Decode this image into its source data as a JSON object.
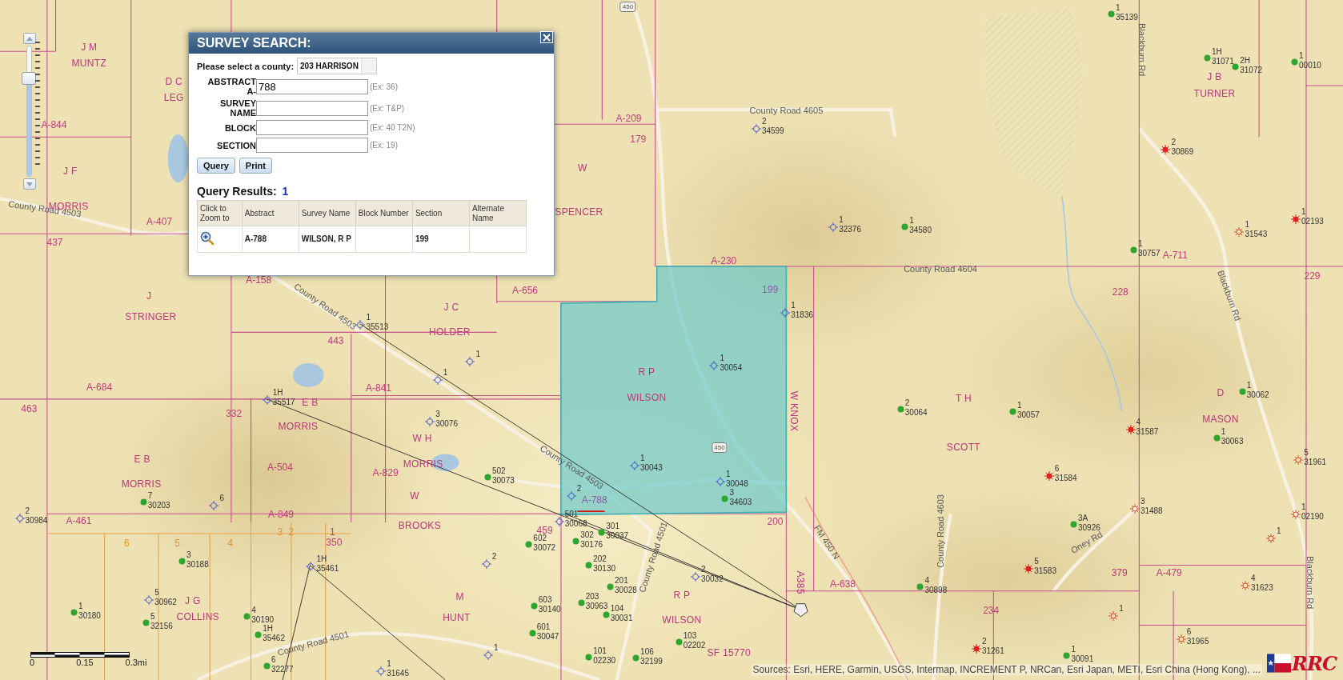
{
  "map": {
    "survey_labels": [
      {
        "text": "J M"
      },
      {
        "text": "MUNTZ"
      },
      {
        "text": "D C"
      },
      {
        "text": "J B"
      },
      {
        "text": "LEG"
      },
      {
        "text": "TURNER"
      },
      {
        "text": "J F"
      },
      {
        "text": "W"
      },
      {
        "text": "MORRIS"
      },
      {
        "text": "SPENCER"
      },
      {
        "text": "J"
      },
      {
        "text": "J C"
      },
      {
        "text": "STRINGER"
      },
      {
        "text": "HOLDER"
      },
      {
        "text": "R P"
      },
      {
        "text": "E B"
      },
      {
        "text": "WILSON"
      },
      {
        "text": "T H"
      },
      {
        "text": "D"
      },
      {
        "text": "W KNOX"
      },
      {
        "text": "MORRIS"
      },
      {
        "text": "MASON"
      },
      {
        "text": "W H"
      },
      {
        "text": "SCOTT"
      },
      {
        "text": "E B"
      },
      {
        "text": "MORRIS"
      },
      {
        "text": "MORRIS"
      },
      {
        "text": "W"
      },
      {
        "text": "BROOKS"
      },
      {
        "text": "A385"
      },
      {
        "text": "J G"
      },
      {
        "text": "M"
      },
      {
        "text": "R P"
      },
      {
        "text": "COLLINS"
      },
      {
        "text": "HUNT"
      },
      {
        "text": "WILSON"
      },
      {
        "text": "SF 15770"
      }
    ],
    "abstract_labels": [
      {
        "text": "A-844",
        "color": "#c03a7c"
      },
      {
        "text": "A-209",
        "color": "#c03a7c"
      },
      {
        "text": "179",
        "color": "#c03a7c"
      },
      {
        "text": "A-407",
        "color": "#c03a7c"
      },
      {
        "text": "437",
        "color": "#c03a7c"
      },
      {
        "text": "A-230",
        "color": "#c03a7c"
      },
      {
        "text": "A-711",
        "color": "#c03a7c"
      },
      {
        "text": "229",
        "color": "#c03a7c"
      },
      {
        "text": "A-158",
        "color": "#c03a7c"
      },
      {
        "text": "A-656",
        "color": "#c03a7c"
      },
      {
        "text": "199",
        "color": "#8a5aa6"
      },
      {
        "text": "228",
        "color": "#c03a7c"
      },
      {
        "text": "443",
        "color": "#c03a7c"
      },
      {
        "text": "A-684",
        "color": "#c03a7c"
      },
      {
        "text": "A-841",
        "color": "#c03a7c"
      },
      {
        "text": "463",
        "color": "#c03a7c"
      },
      {
        "text": "332",
        "color": "#c03a7c"
      },
      {
        "text": "A-504",
        "color": "#c03a7c"
      },
      {
        "text": "A-829",
        "color": "#c03a7c"
      },
      {
        "text": "A-788",
        "color": "#8a5aa6"
      },
      {
        "text": "A-461",
        "color": "#c03a7c"
      },
      {
        "text": "A-849",
        "color": "#c03a7c"
      },
      {
        "text": "200",
        "color": "#c03a7c"
      },
      {
        "text": "3",
        "color": "#e0962c"
      },
      {
        "text": "2",
        "color": "#e0962c"
      },
      {
        "text": "1",
        "color": "#c03a7c"
      },
      {
        "text": "459",
        "color": "#c03a7c"
      },
      {
        "text": "6",
        "color": "#e0962c"
      },
      {
        "text": "5",
        "color": "#e0962c"
      },
      {
        "text": "4",
        "color": "#e0962c"
      },
      {
        "text": "350",
        "color": "#c03a7c"
      },
      {
        "text": "379",
        "color": "#c03a7c"
      },
      {
        "text": "A-479",
        "color": "#c03a7c"
      },
      {
        "text": "A-638",
        "color": "#c03a7c"
      },
      {
        "text": "234",
        "color": "#c03a7c"
      }
    ],
    "roads": [
      {
        "text": "Blackburn Rd"
      },
      {
        "text": "County Road 4605"
      },
      {
        "text": "County Road 4503"
      },
      {
        "text": "County Road 4604"
      },
      {
        "text": "Blackburn Rd"
      },
      {
        "text": "County Road 4503"
      },
      {
        "text": "County Road 4503"
      },
      {
        "text": "County Road 4603"
      },
      {
        "text": "FM 450 N"
      },
      {
        "text": "Oney Rd"
      },
      {
        "text": "County Road 4501"
      },
      {
        "text": "Blackburn Rd"
      },
      {
        "text": "County Road 4501"
      }
    ],
    "highway_shields": [
      {
        "text": "450"
      },
      {
        "text": "450"
      }
    ],
    "wells": [
      {
        "kind": "oil",
        "number": "1",
        "lease": "35139"
      },
      {
        "kind": "oil",
        "number": "1H",
        "lease": "31071"
      },
      {
        "kind": "oil",
        "number": "2H",
        "lease": "31072"
      },
      {
        "kind": "oil",
        "number": "1",
        "lease": "00010"
      },
      {
        "kind": "permit",
        "number": "2",
        "lease": "34599"
      },
      {
        "kind": "gas",
        "number": "2",
        "lease": "30869"
      },
      {
        "kind": "permit",
        "number": "1",
        "lease": "32376"
      },
      {
        "kind": "oil",
        "number": "1",
        "lease": "34580"
      },
      {
        "kind": "plugged",
        "number": "1",
        "lease": "31543"
      },
      {
        "kind": "gas",
        "number": "1",
        "lease": "02193"
      },
      {
        "kind": "oil",
        "number": "1",
        "lease": "30757"
      },
      {
        "kind": "permit",
        "number": "1",
        "lease": "31836"
      },
      {
        "kind": "permit",
        "number": "1",
        "lease": "35513"
      },
      {
        "kind": "permit",
        "number": "1"
      },
      {
        "kind": "permit",
        "number": "1",
        "lease": "30054"
      },
      {
        "kind": "permit",
        "number": "1"
      },
      {
        "kind": "permit",
        "number": "1H",
        "lease": "35517"
      },
      {
        "kind": "oil",
        "number": "1",
        "lease": "30062"
      },
      {
        "kind": "oil",
        "number": "2",
        "lease": "30064"
      },
      {
        "kind": "oil",
        "number": "1",
        "lease": "30057"
      },
      {
        "kind": "permit",
        "number": "3",
        "lease": "30076"
      },
      {
        "kind": "gas",
        "number": "4",
        "lease": "31587"
      },
      {
        "kind": "oil",
        "number": "1",
        "lease": "30063"
      },
      {
        "kind": "permit",
        "number": "1",
        "lease": "30043"
      },
      {
        "kind": "plugged",
        "number": "5",
        "lease": "31961"
      },
      {
        "kind": "oil",
        "number": "502",
        "lease": "30073"
      },
      {
        "kind": "permit",
        "number": "1",
        "lease": "30048"
      },
      {
        "kind": "gas",
        "number": "6",
        "lease": "31584"
      },
      {
        "kind": "oil",
        "number": "7",
        "lease": "30203"
      },
      {
        "kind": "permit",
        "number": "6"
      },
      {
        "kind": "permit",
        "number": "2"
      },
      {
        "kind": "oil",
        "number": "3",
        "lease": "34603"
      },
      {
        "kind": "plugged",
        "number": "3",
        "lease": "31488"
      },
      {
        "kind": "permit",
        "number": "2",
        "lease": "30984"
      },
      {
        "kind": "permit",
        "number": "501",
        "lease": "30068"
      },
      {
        "kind": "oil",
        "number": "3A",
        "lease": "30926"
      },
      {
        "kind": "plugged",
        "number": "1",
        "lease": "02190"
      },
      {
        "kind": "oil",
        "number": "602",
        "lease": "30072"
      },
      {
        "kind": "oil",
        "number": "302",
        "lease": "30176"
      },
      {
        "kind": "oil",
        "number": "301",
        "lease": "30037"
      },
      {
        "kind": "plugged",
        "number": "1"
      },
      {
        "kind": "oil",
        "number": "3",
        "lease": "30188"
      },
      {
        "kind": "permit",
        "number": "1H",
        "lease": "35461"
      },
      {
        "kind": "permit",
        "number": "2"
      },
      {
        "kind": "oil",
        "number": "202",
        "lease": "30130"
      },
      {
        "kind": "gas",
        "number": "5",
        "lease": "31583"
      },
      {
        "kind": "permit",
        "number": "2",
        "lease": "30032"
      },
      {
        "kind": "oil",
        "number": "201",
        "lease": "30028"
      },
      {
        "kind": "oil",
        "number": "4",
        "lease": "30898"
      },
      {
        "kind": "plugged",
        "number": "4",
        "lease": "31623"
      },
      {
        "kind": "permit",
        "number": "5",
        "lease": "30962"
      },
      {
        "kind": "oil",
        "number": "603",
        "lease": "30140"
      },
      {
        "kind": "oil",
        "number": "203",
        "lease": "30963"
      },
      {
        "kind": "oil",
        "number": "1",
        "lease": "30180"
      },
      {
        "kind": "oil",
        "number": "5",
        "lease": "32156"
      },
      {
        "kind": "oil",
        "number": "4",
        "lease": "30190"
      },
      {
        "kind": "oil",
        "number": "104",
        "lease": "30031"
      },
      {
        "kind": "plugged",
        "number": "1"
      },
      {
        "kind": "oil",
        "number": "1H",
        "lease": "35462"
      },
      {
        "kind": "oil",
        "number": "601",
        "lease": "30047"
      },
      {
        "kind": "plugged",
        "number": "6",
        "lease": "31965"
      },
      {
        "kind": "oil",
        "number": "103",
        "lease": "02202"
      },
      {
        "kind": "gas",
        "number": "2",
        "lease": "31261"
      },
      {
        "kind": "permit",
        "number": "1"
      },
      {
        "kind": "oil",
        "number": "101",
        "lease": "02230"
      },
      {
        "kind": "oil",
        "number": "106",
        "lease": "32199"
      },
      {
        "kind": "oil",
        "number": "1",
        "lease": "30091"
      },
      {
        "kind": "oil",
        "number": "6",
        "lease": "32277"
      },
      {
        "kind": "permit",
        "number": "1",
        "lease": "31645"
      }
    ]
  },
  "zoom_slider": {
    "level": 0.75
  },
  "scale_bar": {
    "labels": [
      "0",
      "0.15",
      "0.3mi"
    ]
  },
  "attribution": "Sources: Esri, HERE, Garmin, USGS, Intermap, INCREMENT P, NRCan, Esri Japan, METI, Esri China (Hong Kong), ...",
  "logo": {
    "text": "RRC"
  },
  "survey_search": {
    "title": "SURVEY SEARCH:",
    "county_label": "Please select a county:",
    "county_value": "203 HARRISON",
    "fields": [
      {
        "label": "ABSTRACT A-",
        "value": "788",
        "hint": "(Ex: 36)"
      },
      {
        "label": "SURVEY NAME",
        "hint": "(Ex: T&P)"
      },
      {
        "label": "BLOCK",
        "hint": "(Ex: 40 T2N)"
      },
      {
        "label": "SECTION",
        "hint": "(Ex: 19)"
      }
    ],
    "buttons": [
      "Query",
      "Print"
    ],
    "results_label": "Query Results:",
    "results_count": "1",
    "columns": [
      "Click to Zoom to",
      "Abstract",
      "Survey Name",
      "Block Number",
      "Section",
      "Alternate Name"
    ],
    "rows": [
      {
        "abstract": "A-788",
        "survey_name": "WILSON, R P",
        "section": "199"
      }
    ]
  }
}
